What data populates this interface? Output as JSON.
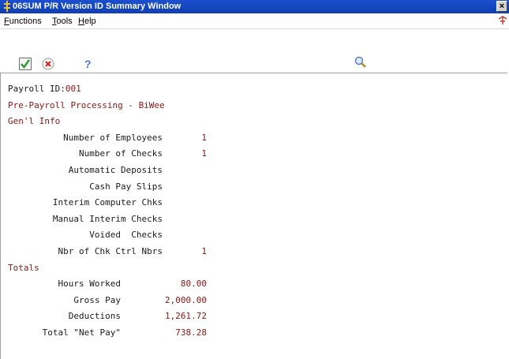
{
  "window": {
    "title": "06SUM  P/R Version ID Summary Window",
    "close_glyph": "×"
  },
  "menu": {
    "functions_first": "F",
    "functions_rest": "unctions",
    "tools_first": "T",
    "tools_rest": "ools",
    "help_first": "H",
    "help_rest": "elp"
  },
  "toolbar": {
    "ok_icon": "check-icon",
    "cancel_icon": "cancel-icon",
    "help_icon": "help-icon",
    "help_glyph": "?",
    "search_icon": "magnifier-icon"
  },
  "form": {
    "payroll_id_label": "Payroll ID:",
    "payroll_id_value": "001",
    "process_title": "Pre-Payroll Processing - BiWee",
    "gen_info_heading": "Gen'l Info",
    "gen_info_rows": [
      {
        "label": "Number of Employees",
        "value": "1"
      },
      {
        "label": "Number of Checks",
        "value": "1"
      },
      {
        "label": "Automatic Deposits",
        "value": ""
      },
      {
        "label": "Cash Pay Slips",
        "value": ""
      },
      {
        "label": "Interim Computer Chks",
        "value": ""
      },
      {
        "label": "Manual Interim Checks",
        "value": ""
      },
      {
        "label": "Voided  Checks",
        "value": ""
      },
      {
        "label": "Nbr of Chk Ctrl Nbrs",
        "value": "1"
      }
    ],
    "totals_heading": "Totals",
    "totals_rows": [
      {
        "label": "Hours Worked",
        "value": "80.00"
      },
      {
        "label": "Gross Pay",
        "value": "2,000.00"
      },
      {
        "label": "Deductions",
        "value": "1,261.72"
      },
      {
        "label": "Total \"Net Pay\"",
        "value": "738.28"
      }
    ]
  },
  "colors": {
    "title_bar": "#1c4fcf",
    "value_text": "#8b1414"
  }
}
